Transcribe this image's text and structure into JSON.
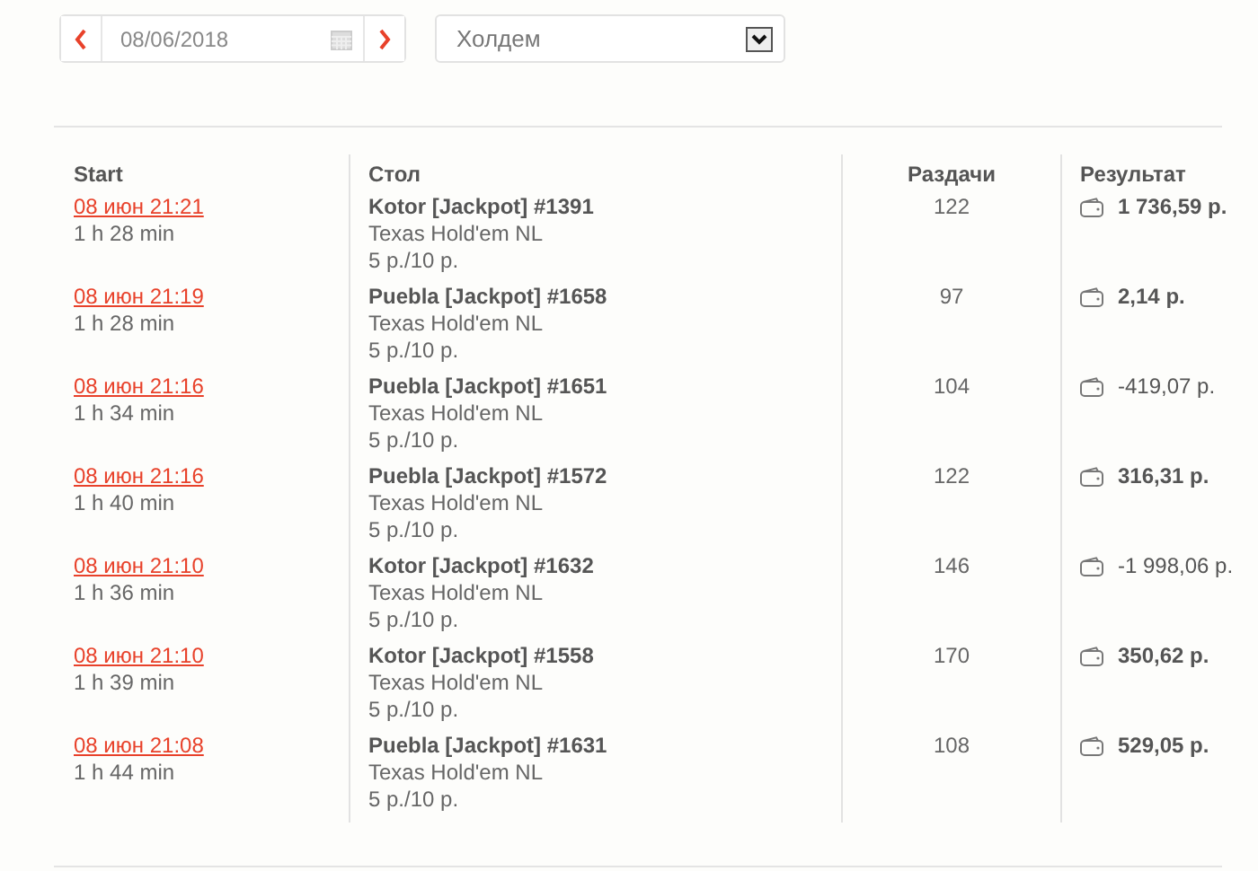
{
  "date_picker": {
    "value": "08/06/2018"
  },
  "game_select": {
    "value": "Холдем"
  },
  "table": {
    "columns": [
      "Start",
      "Стол",
      "Раздачи",
      "Результат"
    ],
    "rows": [
      {
        "start": "08 июн 21:21",
        "duration": "1 h 28 min",
        "table": "Kotor [Jackpot] #1391",
        "game": "Texas Hold'em NL",
        "stakes": "5 р./10 р.",
        "hands": "122",
        "result": "1 736,59 р.",
        "positive": true
      },
      {
        "start": "08 июн 21:19",
        "duration": "1 h 28 min",
        "table": "Puebla [Jackpot] #1658",
        "game": "Texas Hold'em NL",
        "stakes": "5 р./10 р.",
        "hands": "97",
        "result": "2,14 р.",
        "positive": true
      },
      {
        "start": "08 июн 21:16",
        "duration": "1 h 34 min",
        "table": "Puebla [Jackpot] #1651",
        "game": "Texas Hold'em NL",
        "stakes": "5 р./10 р.",
        "hands": "104",
        "result": "-419,07 р.",
        "positive": false
      },
      {
        "start": "08 июн 21:16",
        "duration": "1 h 40 min",
        "table": "Puebla [Jackpot] #1572",
        "game": "Texas Hold'em NL",
        "stakes": "5 р./10 р.",
        "hands": "122",
        "result": "316,31 р.",
        "positive": true
      },
      {
        "start": "08 июн 21:10",
        "duration": "1 h 36 min",
        "table": "Kotor [Jackpot] #1632",
        "game": "Texas Hold'em NL",
        "stakes": "5 р./10 р.",
        "hands": "146",
        "result": "-1 998,06 р.",
        "positive": false
      },
      {
        "start": "08 июн 21:10",
        "duration": "1 h 39 min",
        "table": "Kotor [Jackpot] #1558",
        "game": "Texas Hold'em NL",
        "stakes": "5 р./10 р.",
        "hands": "170",
        "result": "350,62 р.",
        "positive": true
      },
      {
        "start": "08 июн 21:08",
        "duration": "1 h 44 min",
        "table": "Puebla [Jackpot] #1631",
        "game": "Texas Hold'em NL",
        "stakes": "5 р./10 р.",
        "hands": "108",
        "result": "529,05 р.",
        "positive": true
      }
    ]
  }
}
